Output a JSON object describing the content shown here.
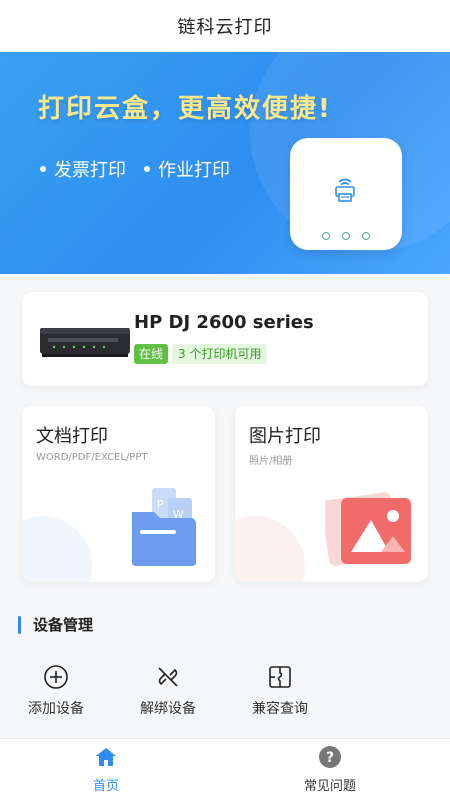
{
  "header": {
    "title": "链科云打印"
  },
  "banner": {
    "headline": "打印云盒，更高效便捷!",
    "tags": [
      "发票打印",
      "作业打印"
    ]
  },
  "printer": {
    "name": "HP DJ 2600 series",
    "status": "在线",
    "available": "3 个打印机可用"
  },
  "functions": {
    "doc": {
      "title": "文档打印",
      "subtitle": "WORD/PDF/EXCEL/PPT"
    },
    "pic": {
      "title": "图片打印",
      "subtitle": "照片/相册"
    }
  },
  "device_section": {
    "title": "设备管理",
    "items": [
      {
        "label": "添加设备",
        "icon": "plus-circle-icon"
      },
      {
        "label": "解绑设备",
        "icon": "unlink-icon"
      },
      {
        "label": "兼容查询",
        "icon": "puzzle-icon"
      }
    ]
  },
  "tabbar": {
    "items": [
      {
        "label": "首页",
        "icon": "home-icon",
        "active": true
      },
      {
        "label": "常见问题",
        "icon": "help-icon",
        "active": false
      }
    ]
  },
  "colors": {
    "accent": "#2e8ef0",
    "headline": "#ffe88a",
    "online": "#5fc143"
  }
}
